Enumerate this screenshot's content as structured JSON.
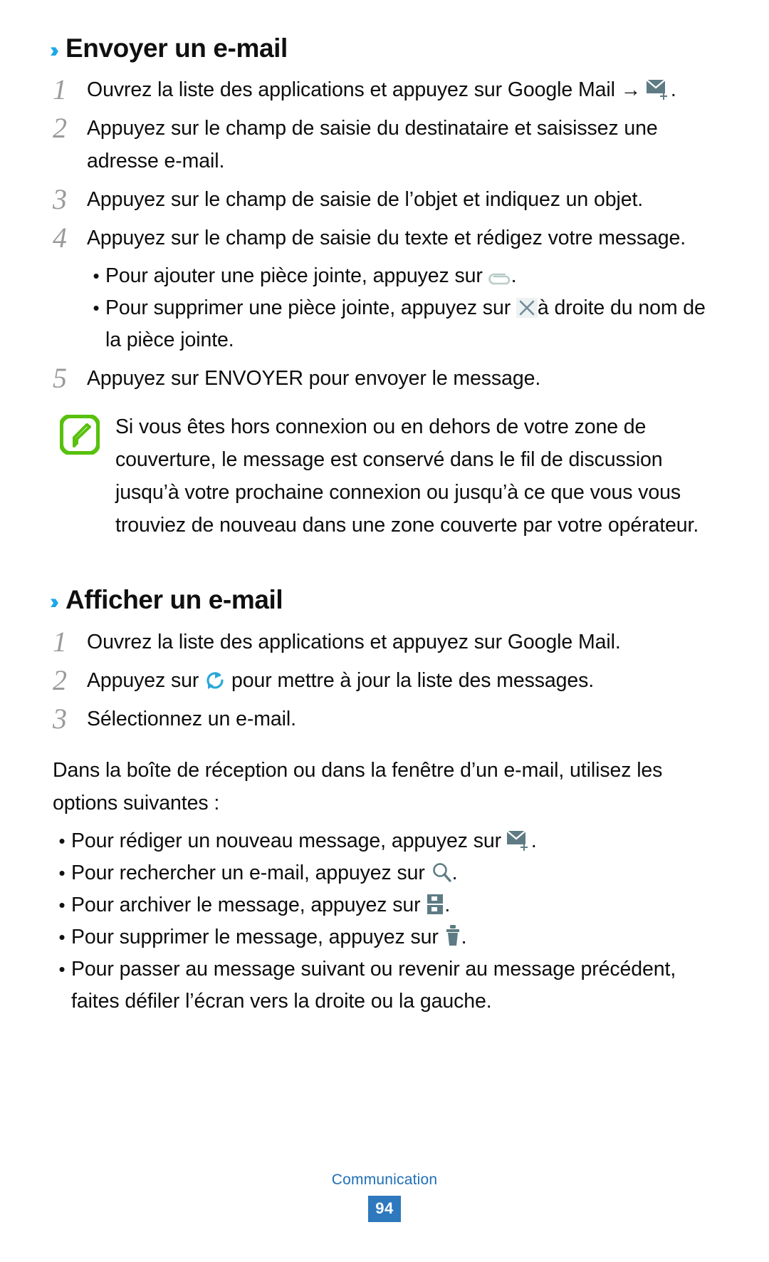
{
  "document": {
    "type": "user-manual-page",
    "language": "fr",
    "page_number": "94",
    "footer_label": "Communication"
  },
  "colors": {
    "heading_chevron": "#1ca8e8",
    "step_number": "#9a9a9a",
    "note_icon_green": "#57c10c",
    "icon_slate": "#51707a",
    "footer_link": "#1f6fb5",
    "page_badge": "#2e78bd",
    "text": "#0d0d0d"
  },
  "sections": [
    {
      "id": "envoyer-un-email",
      "chevron": "››",
      "title": "Envoyer un e-mail",
      "steps": [
        {
          "num": "1",
          "text_before": "Ouvrez la liste des applications et appuyez sur Google Mail",
          "arrow": "→",
          "icon": "compose-mail-icon",
          "text_after": "."
        },
        {
          "num": "2",
          "text_before": "Appuyez sur le champ de saisie du destinataire et saisissez une adresse e-mail.",
          "icon": null,
          "text_after": ""
        },
        {
          "num": "3",
          "text_before": "Appuyez sur le champ de saisie de l’objet et indiquez un objet.",
          "icon": null,
          "text_after": ""
        },
        {
          "num": "4",
          "text_before": "Appuyez sur le champ de saisie du texte et rédigez votre message.",
          "icon": null,
          "text_after": ""
        },
        {
          "num": "5",
          "text_before": "Appuyez sur ENVOYER pour envoyer le message.",
          "icon": null,
          "text_after": ""
        }
      ],
      "sub_bullets": [
        {
          "text_before": "Pour ajouter une pièce jointe, appuyez sur",
          "icon": "paperclip-icon",
          "text_after": "."
        },
        {
          "text_before": "Pour supprimer une pièce jointe, appuyez sur",
          "icon": "close-x-icon",
          "text_after": "à droite du nom de la pièce jointe."
        }
      ],
      "note": {
        "icon": "note-leaf-icon",
        "text": "Si vous êtes hors connexion ou en dehors de votre zone de couverture, le message est conservé dans le fil de discussion jusqu’à votre prochaine connexion ou jusqu’à ce que vous vous trouviez de nouveau dans une zone couverte par votre opérateur."
      }
    },
    {
      "id": "afficher-un-email",
      "chevron": "››",
      "title": "Afficher un e-mail",
      "steps": [
        {
          "num": "1",
          "text_before": "Ouvrez la liste des applications et appuyez sur Google Mail.",
          "icon": null,
          "text_after": ""
        },
        {
          "num": "2",
          "text_before": "Appuyez sur",
          "icon": "refresh-icon",
          "text_after": "pour mettre à jour la liste des messages."
        },
        {
          "num": "3",
          "text_before": "Sélectionnez un e-mail.",
          "icon": null,
          "text_after": ""
        }
      ],
      "paragraph": "Dans la boîte de réception ou dans la fenêtre d’un e-mail, utilisez les options suivantes :",
      "options": [
        {
          "text_before": "Pour rédiger un nouveau message, appuyez sur",
          "icon": "compose-mail-icon",
          "text_after": "."
        },
        {
          "text_before": "Pour rechercher un e-mail, appuyez sur",
          "icon": "search-icon",
          "text_after": "."
        },
        {
          "text_before": "Pour archiver le message, appuyez sur",
          "icon": "archive-cabinet-icon",
          "text_after": "."
        },
        {
          "text_before": "Pour supprimer le message, appuyez sur",
          "icon": "trash-icon",
          "text_after": "."
        },
        {
          "text_before": "Pour passer au message suivant ou revenir au message précédent, faites défiler l’écran vers la droite ou la gauche.",
          "icon": null,
          "text_after": ""
        }
      ]
    }
  ]
}
